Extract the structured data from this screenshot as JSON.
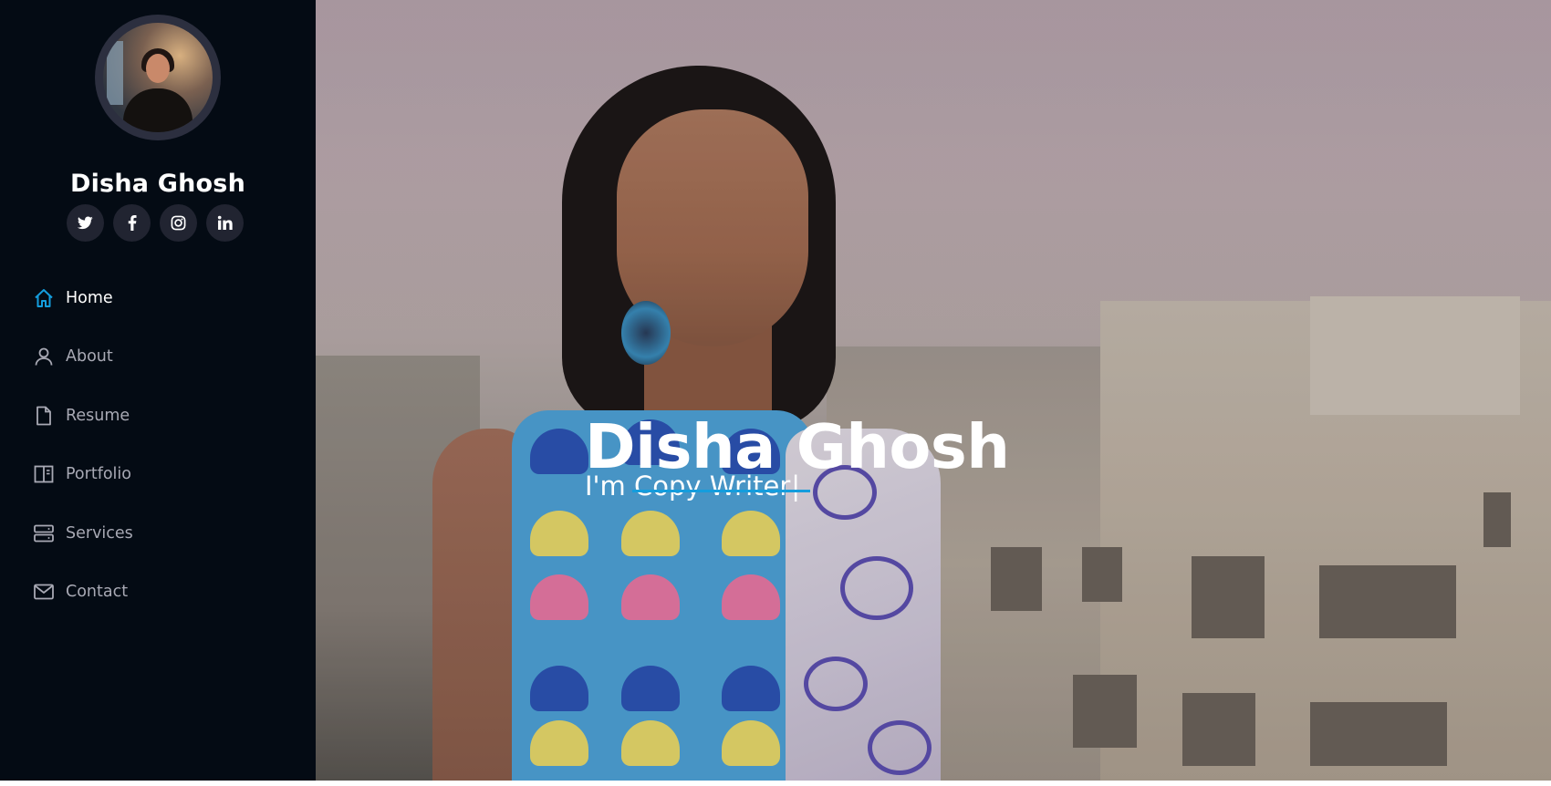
{
  "profile": {
    "name": "Disha Ghosh",
    "avatar_alt": "profile-photo"
  },
  "social": [
    {
      "name": "twitter",
      "icon": "twitter-icon"
    },
    {
      "name": "facebook",
      "icon": "facebook-icon"
    },
    {
      "name": "instagram",
      "icon": "instagram-icon"
    },
    {
      "name": "linkedin",
      "icon": "linkedin-icon"
    }
  ],
  "nav": {
    "items": [
      {
        "label": "Home",
        "icon": "home-icon",
        "active": true
      },
      {
        "label": "About",
        "icon": "user-icon",
        "active": false
      },
      {
        "label": "Resume",
        "icon": "file-icon",
        "active": false
      },
      {
        "label": "Portfolio",
        "icon": "book-icon",
        "active": false
      },
      {
        "label": "Services",
        "icon": "server-icon",
        "active": false
      },
      {
        "label": "Contact",
        "icon": "envelope-icon",
        "active": false
      }
    ]
  },
  "hero": {
    "title": "Disha Ghosh",
    "subtitle": "I'm Copy Writer",
    "cursor": "|"
  },
  "colors": {
    "accent": "#149ddd",
    "sidebar_bg": "#040b14",
    "social_bg": "#212431",
    "nav_text": "#a8a9b4",
    "nav_active_text": "#ffffff"
  }
}
